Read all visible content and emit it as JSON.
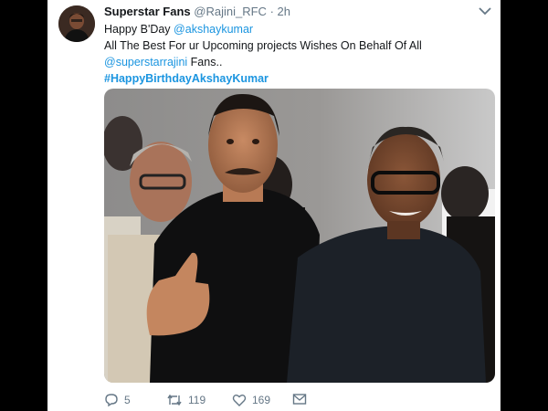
{
  "tweet": {
    "display_name": "Superstar Fans",
    "handle": "@Rajini_RFC",
    "separator": "·",
    "time": "2h",
    "line1_prefix": "Happy B'Day ",
    "line1_mention": "@akshaykumar",
    "line2": "All The Best For ur Upcoming projects Wishes On Behalf Of All",
    "line3_mention": "@superstarrajini",
    "line3_suffix": " Fans..",
    "hashtag": "#HappyBirthdayAkshayKumar"
  },
  "actions": {
    "reply_count": "5",
    "retweet_count": "119",
    "like_count": "169"
  },
  "icons": {
    "reply": "reply-icon",
    "retweet": "retweet-icon",
    "like": "heart-icon",
    "message": "envelope-icon",
    "menu": "chevron-down-icon"
  },
  "colors": {
    "link": "#1b95e0",
    "text": "#14171a",
    "muted": "#657786"
  }
}
